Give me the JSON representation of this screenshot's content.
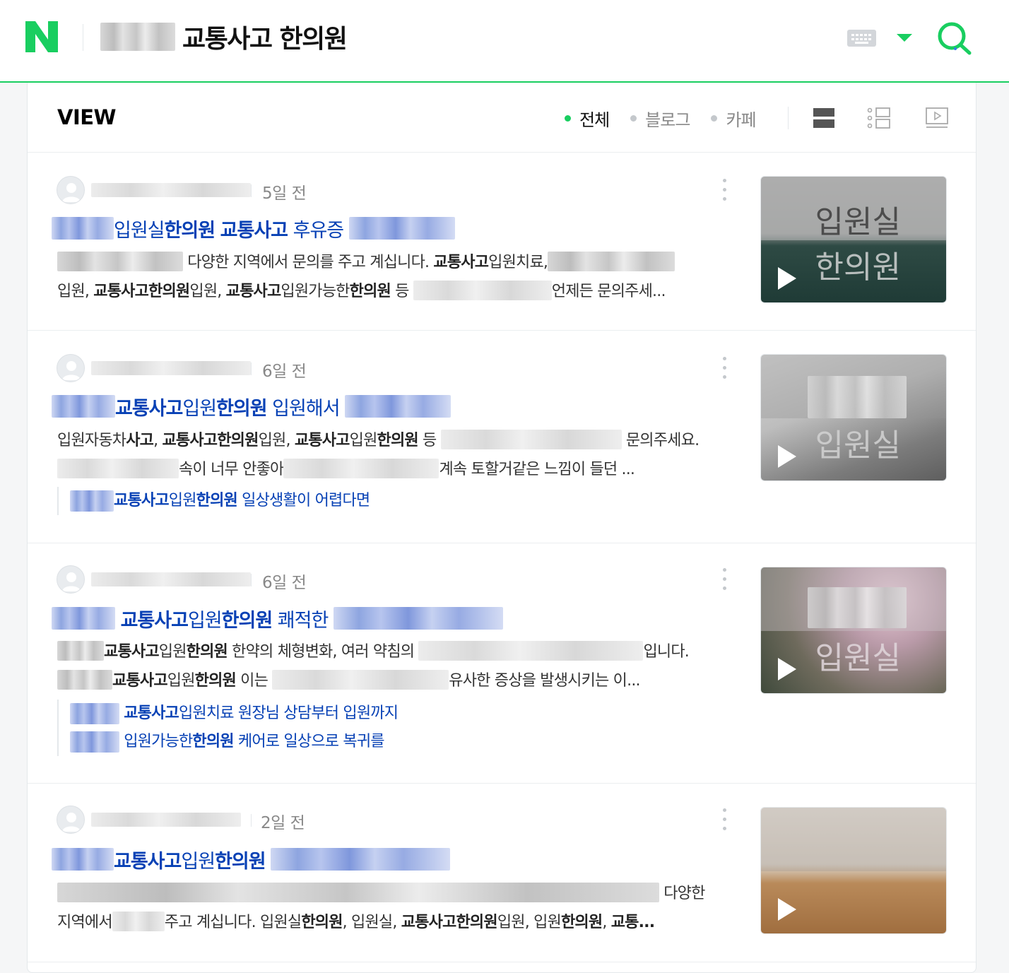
{
  "header": {
    "logo": "N",
    "query": "교통사고 한의원",
    "brand_color": "#19ce60",
    "icons": [
      "keyboard-icon",
      "dropdown-arrow-icon",
      "search-icon"
    ]
  },
  "section": {
    "title": "VIEW",
    "filters": [
      "전체",
      "블로그",
      "카페"
    ],
    "active_filter": "전체",
    "view_modes": [
      "list-view-icon",
      "detail-view-icon",
      "video-view-icon"
    ]
  },
  "results": [
    {
      "date": "5일 전",
      "title_parts": [
        {
          "t": " 입원실",
          "b": false
        },
        {
          "t": "한의원",
          "b": true
        },
        {
          "t": " ",
          "b": false
        },
        {
          "t": "교통사고",
          "b": true
        },
        {
          "t": " 후유증 ",
          "b": false
        }
      ],
      "desc_parts": [
        {
          "t": "다양한 지역에서 문의를 주고 계십니다. ",
          "b": false
        },
        {
          "t": "교통사고",
          "b": true
        },
        {
          "t": "입원치료,",
          "b": false
        },
        {
          "t": "입원, ",
          "b": false
        },
        {
          "t": "교통사고한의원",
          "b": true
        },
        {
          "t": "입원, ",
          "b": false
        },
        {
          "t": "교통사고",
          "b": true
        },
        {
          "t": "입원가능한",
          "b": false
        },
        {
          "t": "한의원",
          "b": true
        },
        {
          "t": " 등 ",
          "b": false
        },
        {
          "t": "언제든 문의주세...",
          "b": false
        }
      ],
      "thumb_text": [
        "입원실",
        "한의원"
      ]
    },
    {
      "date": "6일 전",
      "title_parts": [
        {
          "t": "교통사고",
          "b": true
        },
        {
          "t": "입원",
          "b": false
        },
        {
          "t": "한의원",
          "b": true
        },
        {
          "t": " 입원해서 ",
          "b": false
        }
      ],
      "desc_parts": [
        {
          "t": "입원자동차",
          "b": false
        },
        {
          "t": "사고",
          "b": true
        },
        {
          "t": ", ",
          "b": false
        },
        {
          "t": "교통사고한의원",
          "b": true
        },
        {
          "t": "입원, ",
          "b": false
        },
        {
          "t": "교통사고",
          "b": true
        },
        {
          "t": "입원",
          "b": false
        },
        {
          "t": "한의원",
          "b": true
        },
        {
          "t": " 등 ",
          "b": false
        },
        {
          "t": " 문의주세요. ",
          "b": false
        },
        {
          "t": "속이 너무 안좋아",
          "b": false
        },
        {
          "t": "계속 토할거같은 느낌이 들던 ...",
          "b": false
        }
      ],
      "sub_links": [
        [
          {
            "t": "교통사고",
            "b": true
          },
          {
            "t": "입원",
            "b": false
          },
          {
            "t": "한의원",
            "b": true
          },
          {
            "t": " 일상생활이 어렵다면",
            "b": false
          }
        ]
      ],
      "thumb_text": [
        "입원실"
      ]
    },
    {
      "date": "6일 전",
      "title_parts": [
        {
          "t": " ",
          "b": false
        },
        {
          "t": "교통사고",
          "b": true
        },
        {
          "t": "입원",
          "b": false
        },
        {
          "t": "한의원",
          "b": true
        },
        {
          "t": " 쾌적한 ",
          "b": false
        }
      ],
      "desc_parts": [
        {
          "t": "교통사고",
          "b": true
        },
        {
          "t": "입원",
          "b": false
        },
        {
          "t": "한의원",
          "b": true
        },
        {
          "t": " 한약의 체형변화, 여러 약침의 ",
          "b": false
        },
        {
          "t": "입니다. ",
          "b": false
        },
        {
          "t": "교통사고",
          "b": true
        },
        {
          "t": "입원",
          "b": false
        },
        {
          "t": "한의원",
          "b": true
        },
        {
          "t": " 이는 ",
          "b": false
        },
        {
          "t": "유사한 증상을 발생시키는 이...",
          "b": false
        }
      ],
      "sub_links": [
        [
          {
            "t": " ",
            "b": false
          },
          {
            "t": "교통사고",
            "b": true
          },
          {
            "t": "입원치료 원장님 상담부터 입원까지",
            "b": false
          }
        ],
        [
          {
            "t": " 입원가능한",
            "b": false
          },
          {
            "t": "한의원",
            "b": true
          },
          {
            "t": " 케어로 일상으로 복귀를",
            "b": false
          }
        ]
      ],
      "thumb_text": [
        "입원실"
      ]
    },
    {
      "date": "2일 전",
      "title_parts": [
        {
          "t": "교통사고",
          "b": true
        },
        {
          "t": "입원",
          "b": false
        },
        {
          "t": "한의원",
          "b": true
        },
        {
          "t": " ",
          "b": false
        }
      ],
      "desc_parts": [
        {
          "t": " 다양한",
          "b": false
        },
        {
          "t": "지역에서",
          "b": false
        },
        {
          "t": "주고 계십니다. 입원실",
          "b": false
        },
        {
          "t": "한의원",
          "b": true
        },
        {
          "t": ", 입원실, ",
          "b": false
        },
        {
          "t": "교통사고한의원",
          "b": true
        },
        {
          "t": "입원, 입원",
          "b": false
        },
        {
          "t": "한의원",
          "b": true
        },
        {
          "t": ", ",
          "b": false
        },
        {
          "t": "교통...",
          "b": true
        }
      ],
      "thumb_text": []
    }
  ]
}
